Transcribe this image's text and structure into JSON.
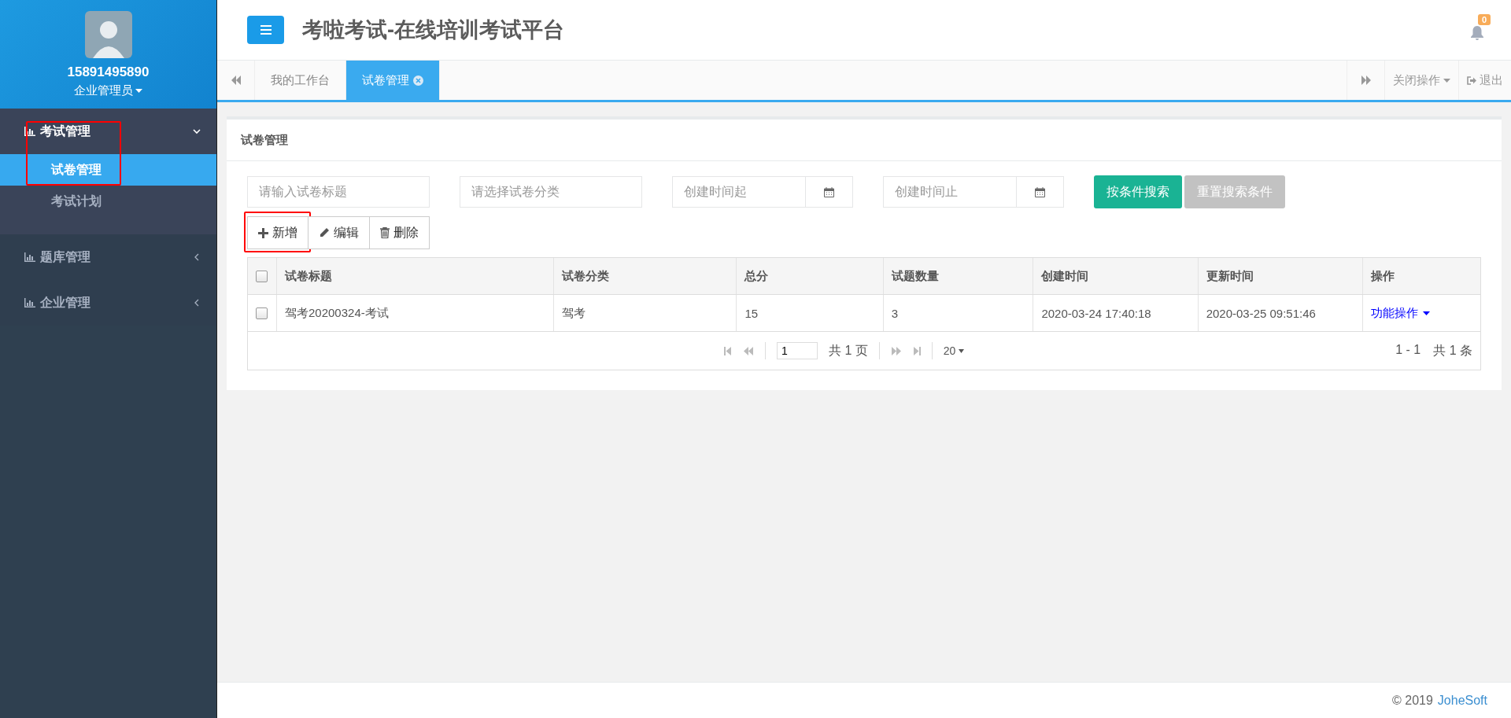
{
  "user": {
    "name": "15891495890",
    "role": "企业管理员"
  },
  "menu": [
    {
      "label": "考试管理",
      "expanded": true,
      "children": [
        {
          "label": "试卷管理",
          "selected": true,
          "annotated": true
        },
        {
          "label": "考试计划",
          "selected": false,
          "annotated": false
        }
      ]
    },
    {
      "label": "题库管理",
      "expanded": false
    },
    {
      "label": "企业管理",
      "expanded": false
    }
  ],
  "header": {
    "title": "考啦考试-在线培训考试平台",
    "notification_count": "0"
  },
  "tabs": [
    {
      "label": "我的工作台",
      "selected": false,
      "closable": false
    },
    {
      "label": "试卷管理",
      "selected": true,
      "closable": true
    }
  ],
  "tab_actions": {
    "close_menu": "关闭操作",
    "logout": "退出"
  },
  "panel": {
    "title": "试卷管理"
  },
  "filters": [
    {
      "kind": "text",
      "placeholder": "请输入试卷标题"
    },
    {
      "kind": "text",
      "placeholder": "请选择试卷分类"
    },
    {
      "kind": "date",
      "placeholder": "创建时间起"
    },
    {
      "kind": "date",
      "placeholder": "创建时间止"
    }
  ],
  "search_buttons": [
    {
      "label": "按条件搜索",
      "disabled": false
    },
    {
      "label": "重置搜索条件",
      "disabled": true
    }
  ],
  "toolbar": [
    {
      "kind": "add",
      "label": "新增",
      "annotated": true
    },
    {
      "kind": "edit",
      "label": "编辑",
      "annotated": false
    },
    {
      "kind": "delete",
      "label": "删除",
      "annotated": false
    }
  ],
  "table": {
    "all_checked": false,
    "columns": [
      "试卷标题",
      "试卷分类",
      "总分",
      "试题数量",
      "创建时间",
      "更新时间",
      "操作"
    ],
    "rows": [
      {
        "checked": false,
        "cells": [
          "驾考20200324-考试",
          "驾考",
          "15",
          "3",
          "2020-03-24 17:40:18",
          "2020-03-25 09:51:46"
        ],
        "action": "功能操作"
      }
    ]
  },
  "pagination": {
    "page": "1",
    "total_pages": "共 1 页",
    "page_size": "20",
    "range": "1 - 1",
    "total": "共 1 条"
  },
  "footer": {
    "copyright": "© 2019",
    "company": "JoheSoft"
  }
}
